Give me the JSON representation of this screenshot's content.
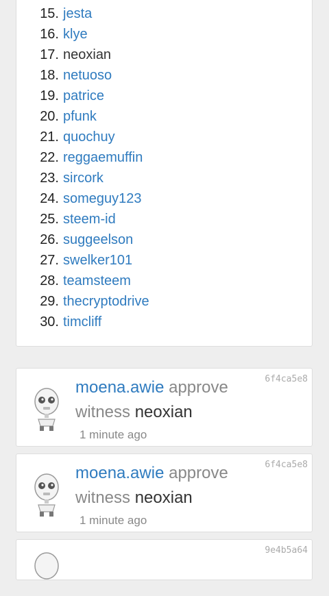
{
  "witness_list": {
    "items": [
      {
        "num": "15.",
        "name": "jesta",
        "linked": true
      },
      {
        "num": "16.",
        "name": "klye",
        "linked": true
      },
      {
        "num": "17.",
        "name": "neoxian",
        "linked": false
      },
      {
        "num": "18.",
        "name": "netuoso",
        "linked": true
      },
      {
        "num": "19.",
        "name": "patrice",
        "linked": true
      },
      {
        "num": "20.",
        "name": "pfunk",
        "linked": true
      },
      {
        "num": "21.",
        "name": "quochuy",
        "linked": true
      },
      {
        "num": "22.",
        "name": "reggaemuffin",
        "linked": true
      },
      {
        "num": "23.",
        "name": "sircork",
        "linked": true
      },
      {
        "num": "24.",
        "name": "someguy123",
        "linked": true
      },
      {
        "num": "25.",
        "name": "steem-id",
        "linked": true
      },
      {
        "num": "26.",
        "name": "suggeelson",
        "linked": true
      },
      {
        "num": "27.",
        "name": "swelker101",
        "linked": true
      },
      {
        "num": "28.",
        "name": "teamsteem",
        "linked": true
      },
      {
        "num": "29.",
        "name": "thecryptodrive",
        "linked": true
      },
      {
        "num": "30.",
        "name": "timcliff",
        "linked": true
      }
    ]
  },
  "operations": [
    {
      "hash": "6f4ca5e8",
      "user": "moena.awie",
      "action": "approve",
      "object": "witness",
      "target": "neoxian",
      "time": "1 minute ago"
    },
    {
      "hash": "6f4ca5e8",
      "user": "moena.awie",
      "action": "approve",
      "object": "witness",
      "target": "neoxian",
      "time": "1 minute ago"
    },
    {
      "hash": "9e4b5a64"
    }
  ],
  "colors": {
    "link": "#2f7bbf",
    "text": "#333333",
    "muted": "#888888",
    "hash": "#aaaaaa",
    "background": "#eeeeee",
    "card": "#ffffff"
  },
  "icons": {
    "avatar": "robot-avatar-icon"
  }
}
